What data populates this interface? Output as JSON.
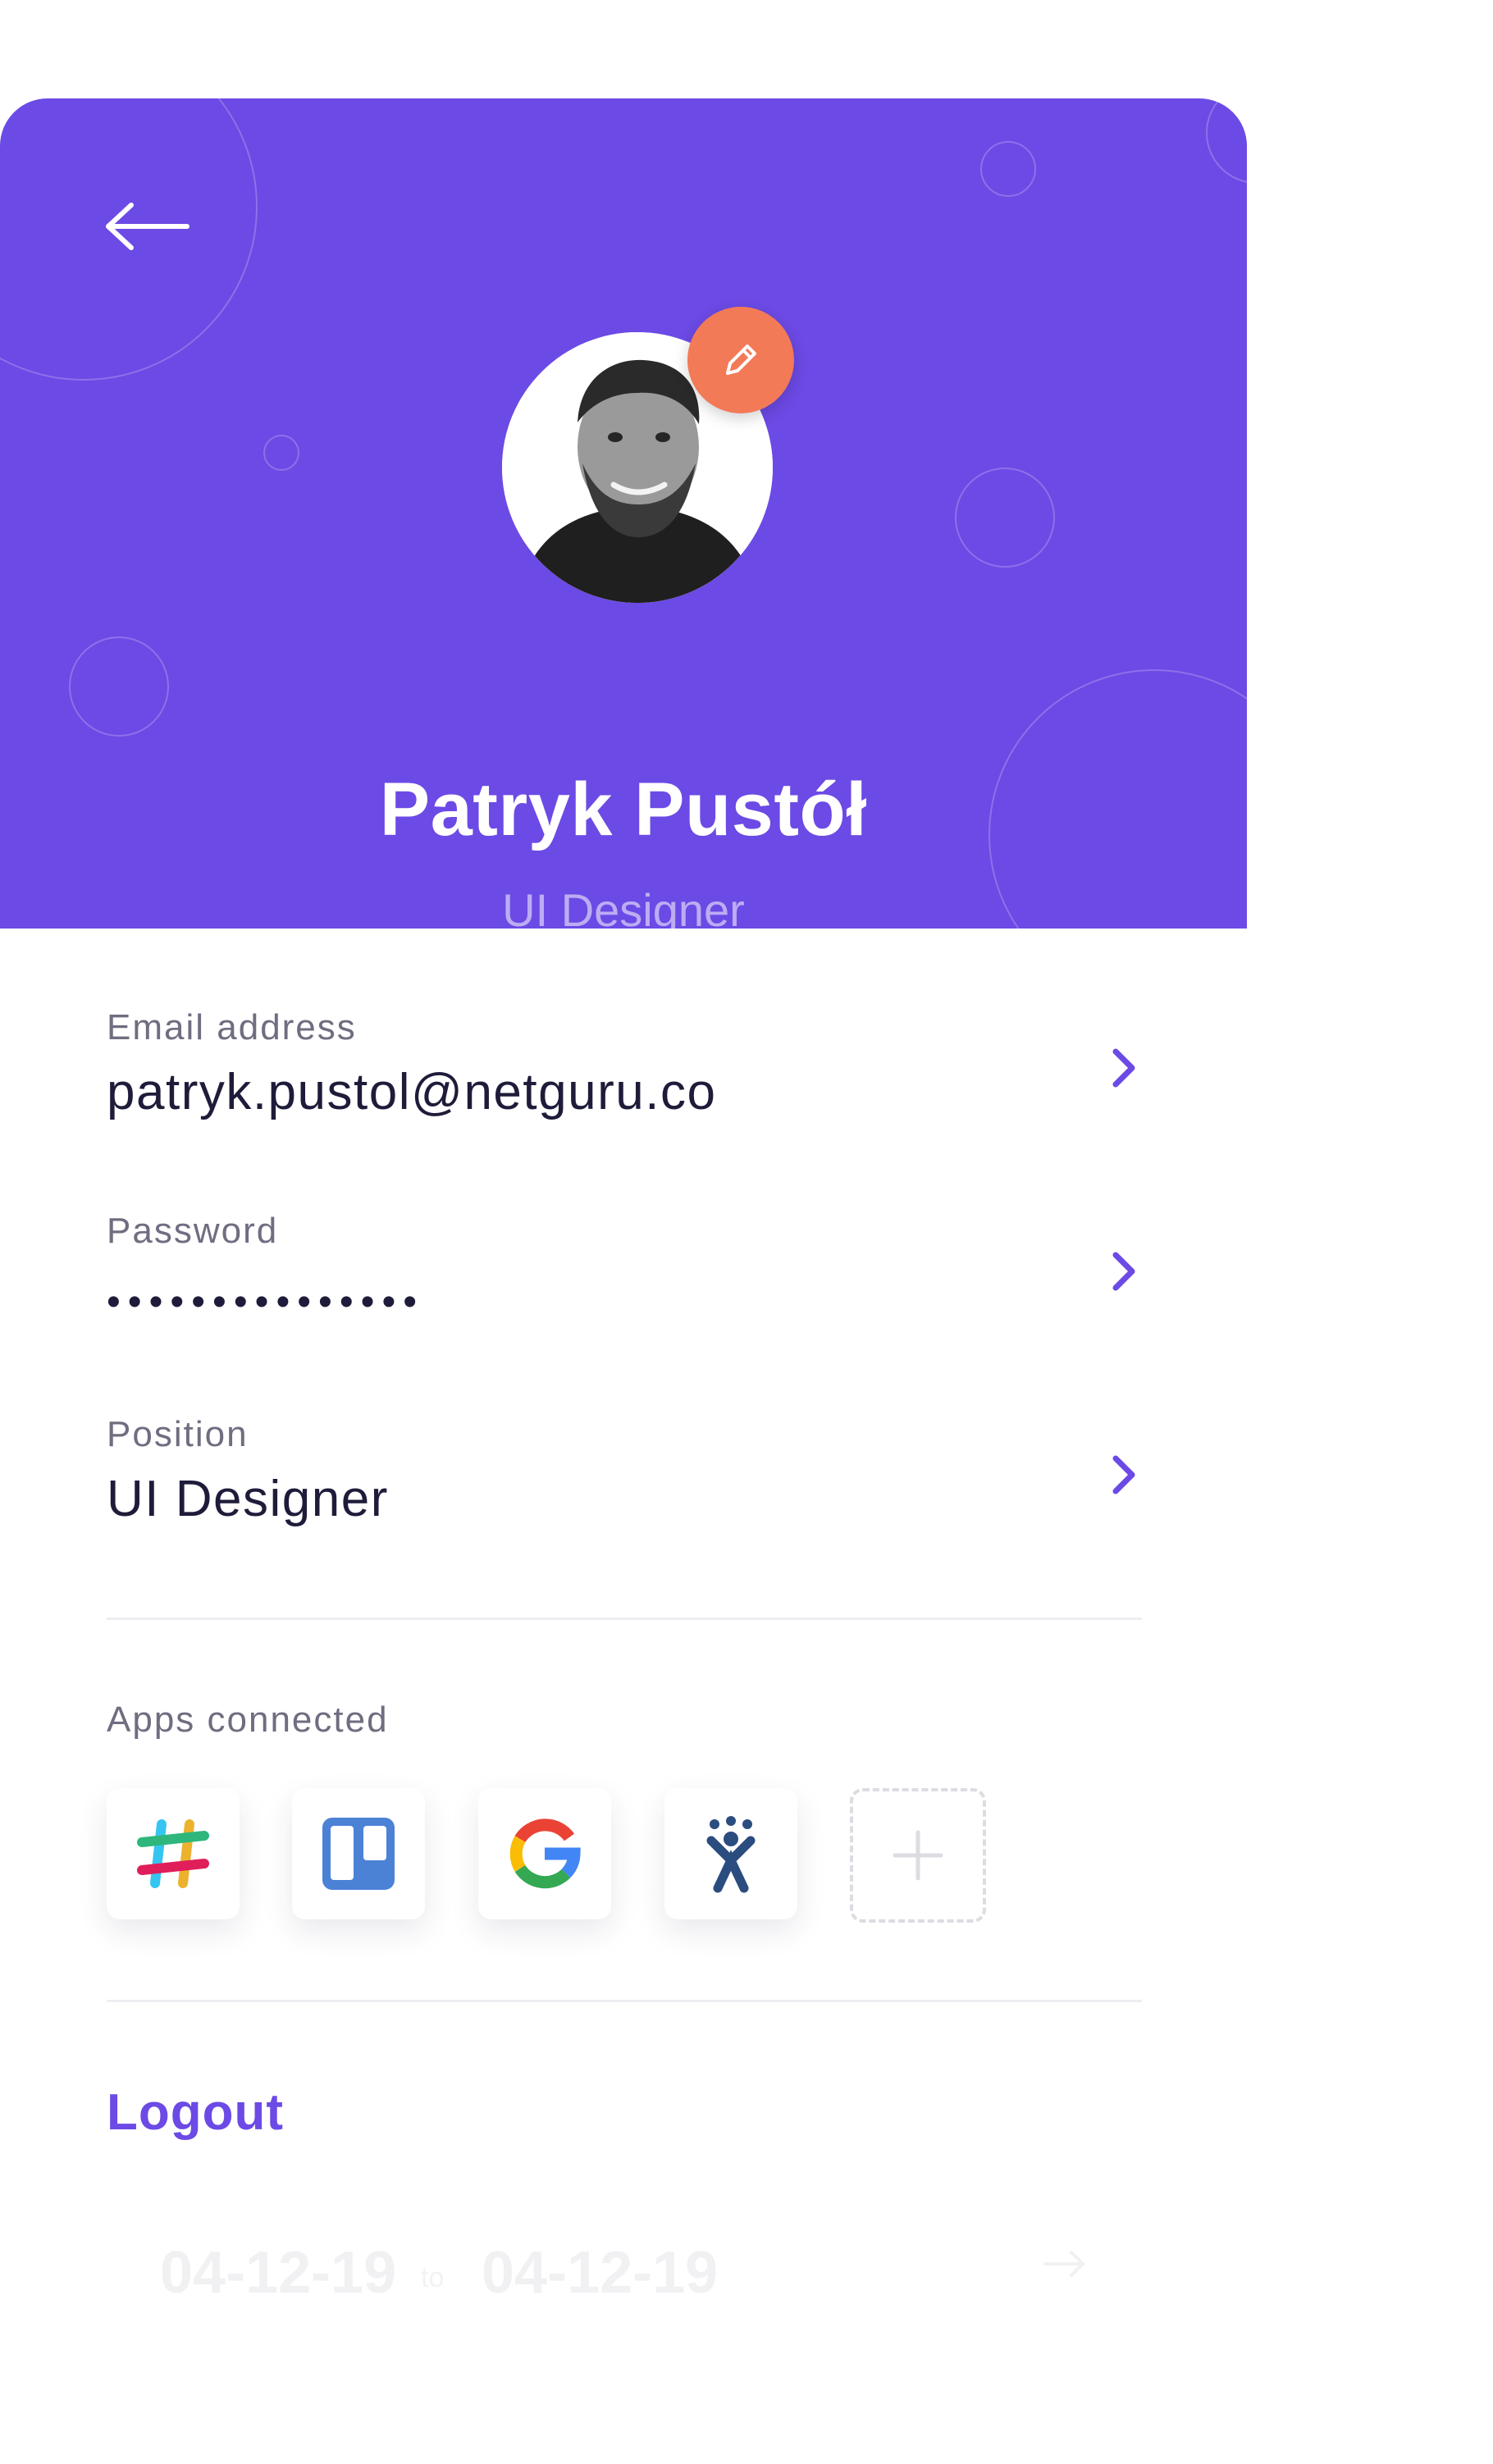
{
  "header": {
    "name": "Patryk Pustół",
    "role": "UI Designer",
    "background_color": "#6c4ae5",
    "back_icon": "arrow-left-icon",
    "edit_icon": "pencil-icon",
    "edit_badge_color": "#f37a57"
  },
  "fields": [
    {
      "label": "Email address",
      "value": "patryk.pustol@netguru.co"
    },
    {
      "label": "Password",
      "value": "•••••••••••••••"
    },
    {
      "label": "Position",
      "value": "UI Designer"
    }
  ],
  "apps": {
    "label": "Apps connected",
    "items": [
      "slack-icon",
      "trello-icon",
      "google-icon",
      "jira-icon"
    ],
    "add_icon": "plus-icon"
  },
  "logout_label": "Logout",
  "faded_row": {
    "from": "04-12-19",
    "to_word": "to",
    "to": "04-12-19"
  },
  "accent_color": "#6c4ae5"
}
